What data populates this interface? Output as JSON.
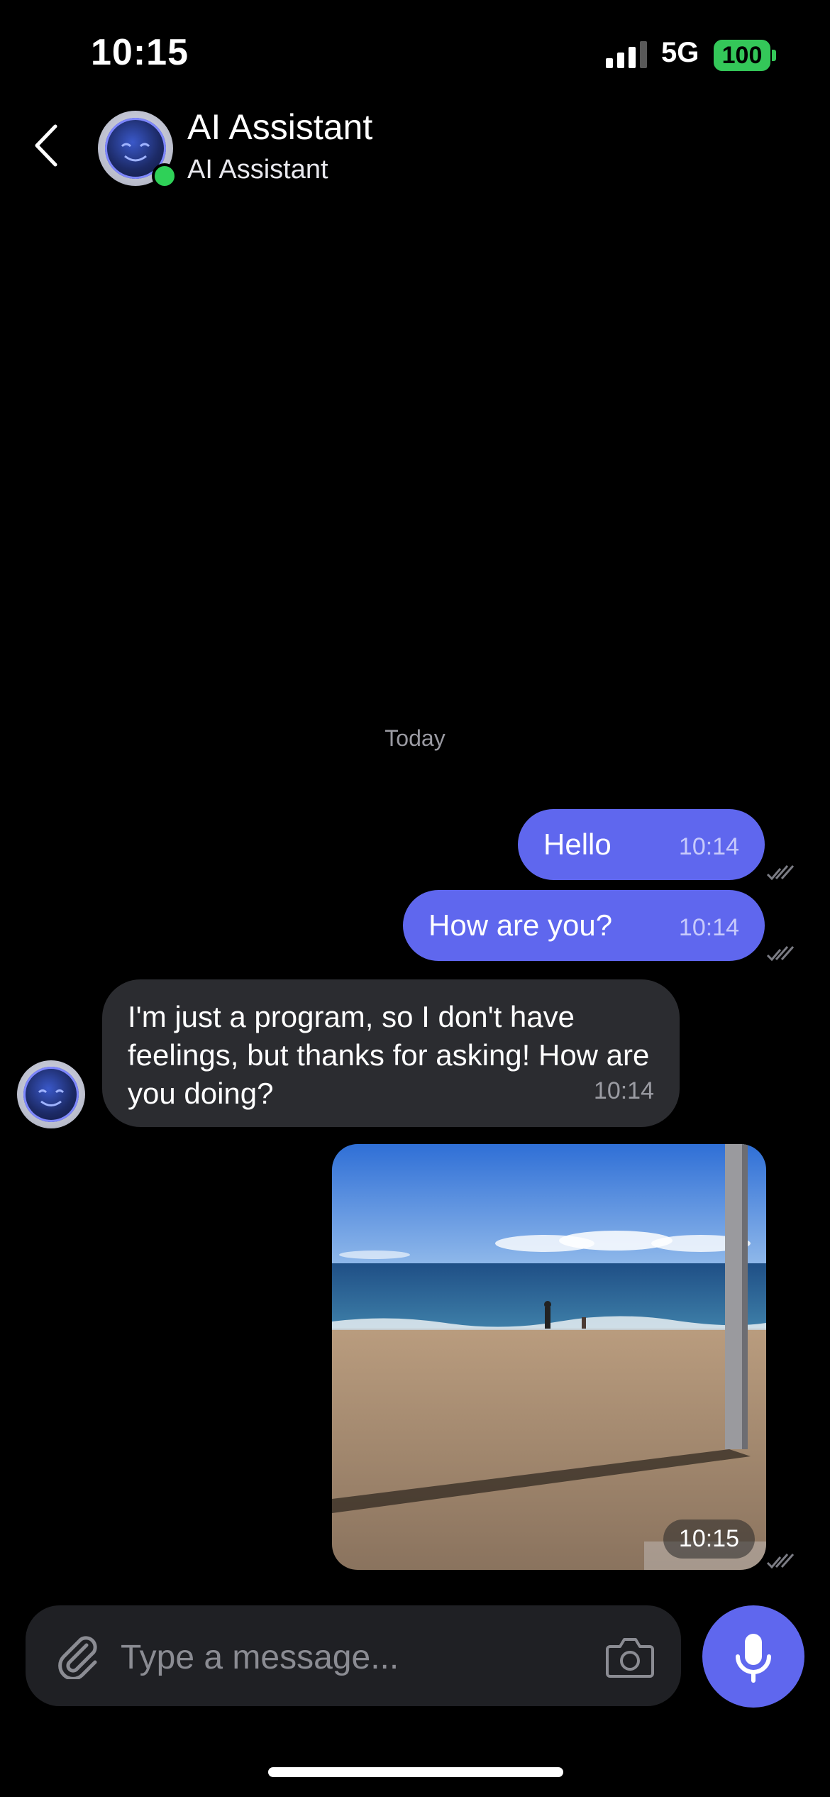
{
  "status_bar": {
    "time": "10:15",
    "network": "5G",
    "battery": "100"
  },
  "header": {
    "title": "AI Assistant",
    "subtitle": "AI Assistant"
  },
  "chat": {
    "date_separator": "Today",
    "messages": [
      {
        "direction": "outgoing",
        "text": "Hello",
        "time": "10:14",
        "status": "read"
      },
      {
        "direction": "outgoing",
        "text": "How are you?",
        "time": "10:14",
        "status": "read"
      },
      {
        "direction": "incoming",
        "text": "I'm just a program, so I don't have feelings, but thanks for asking! How are you doing?",
        "time": "10:14"
      },
      {
        "direction": "outgoing",
        "type": "image",
        "image_description": "beach",
        "time": "10:15",
        "status": "read"
      }
    ]
  },
  "composer": {
    "placeholder": "Type a message..."
  },
  "colors": {
    "accent": "#5f67ee",
    "incoming_bubble": "#2b2c30",
    "online": "#2fd158",
    "battery": "#34c759"
  },
  "icons": [
    "back-chevron-icon",
    "avatar-icon",
    "paperclip-icon",
    "camera-icon",
    "microphone-icon",
    "read-ticks-icon",
    "signal-icon"
  ]
}
